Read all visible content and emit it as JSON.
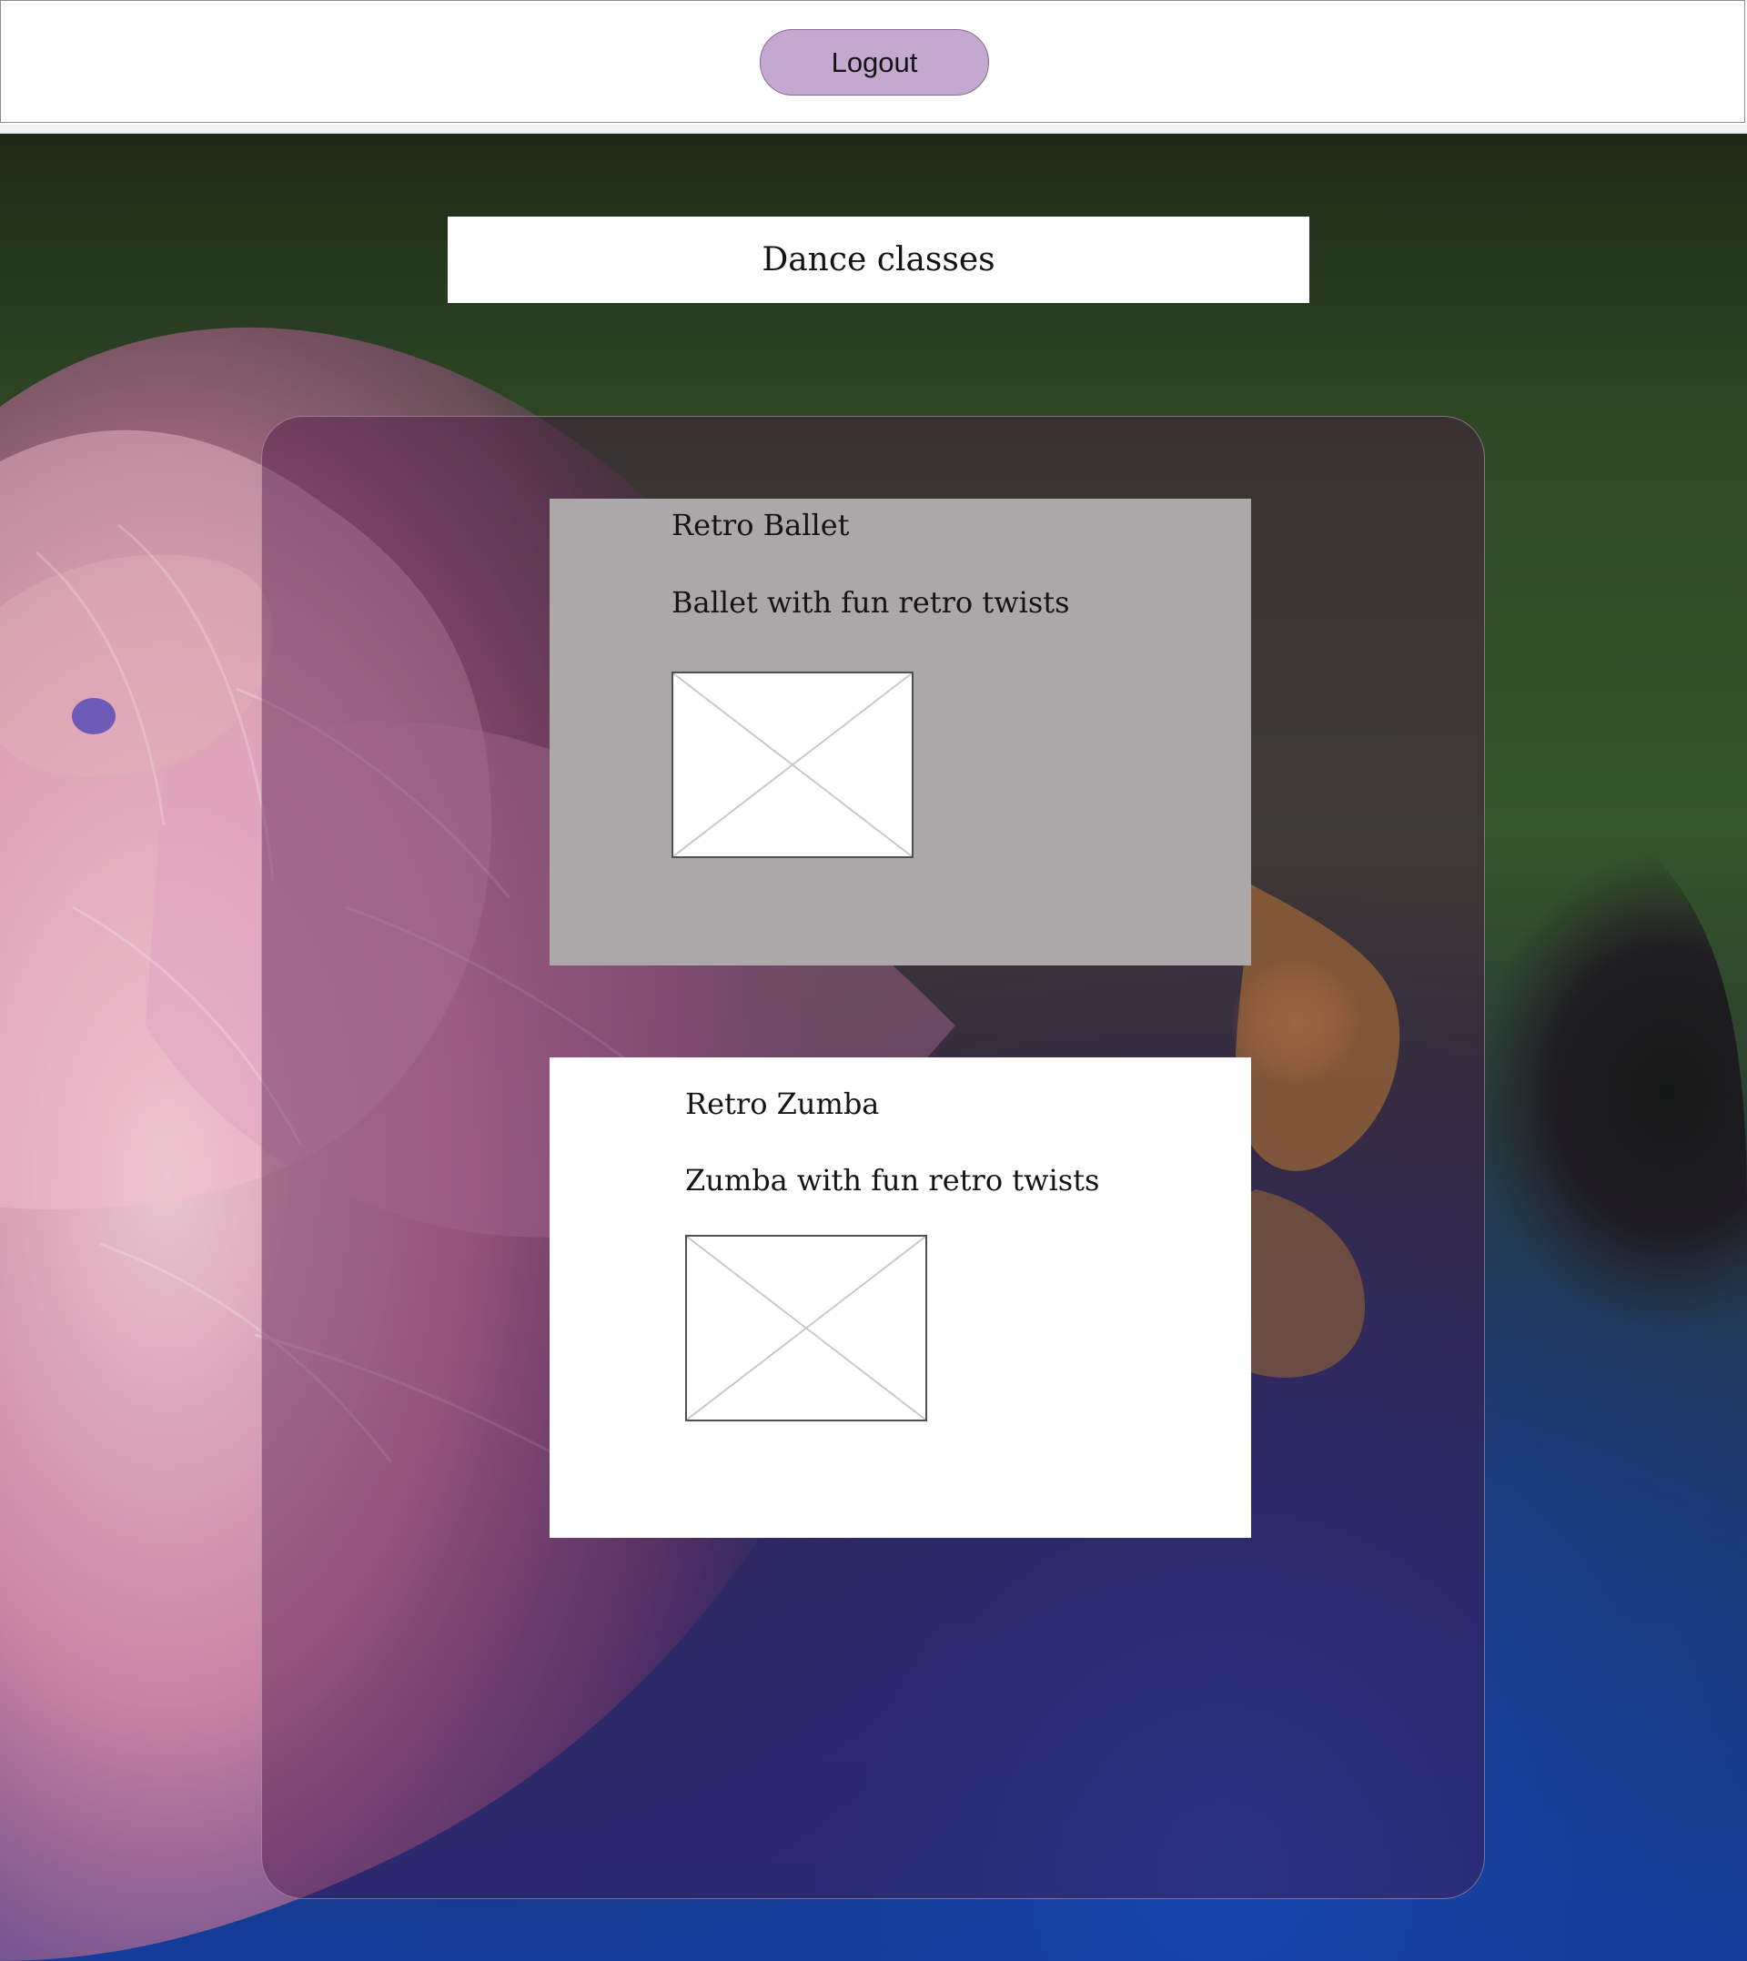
{
  "header": {
    "logout_label": "Logout",
    "logout_icon": "none"
  },
  "page": {
    "title": "Dance classes"
  },
  "classes": [
    {
      "title": "Retro Ballet",
      "description": "Ballet with fun retro twists",
      "image_icon": "image-placeholder-icon"
    },
    {
      "title": "Retro Zumba",
      "description": "Zumba with fun retro twists",
      "image_icon": "image-placeholder-icon"
    }
  ],
  "colors": {
    "logout_button": "#c3a9cf",
    "first_card": "#aca7a8",
    "second_card": "#ffffff",
    "panel_overlay": "rgba(74, 18, 70, 0.42)"
  }
}
